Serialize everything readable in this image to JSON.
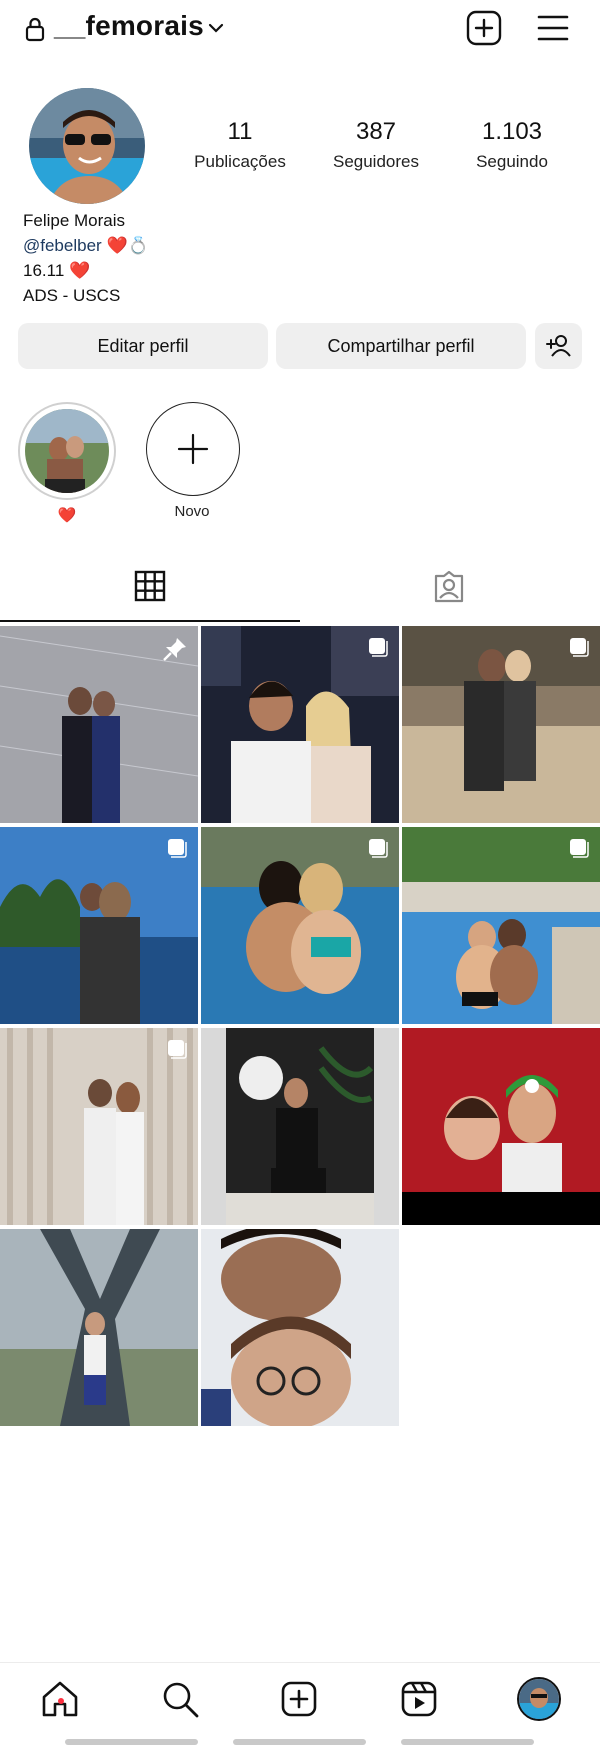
{
  "header": {
    "username": "__femorais",
    "icons": [
      "lock-icon",
      "chevron-down-icon",
      "new-post-icon",
      "menu-icon"
    ]
  },
  "profile": {
    "stats": [
      {
        "value": "11",
        "label": "Publicações"
      },
      {
        "value": "387",
        "label": "Seguidores"
      },
      {
        "value": "1.103",
        "label": "Seguindo"
      }
    ],
    "name": "Felipe Morais",
    "handle": "@febelber",
    "handle_emoji": "❤️💍",
    "line2": "16.11 ❤️",
    "line3": "ADS - USCS"
  },
  "actions": {
    "edit": "Editar perfil",
    "share": "Compartilhar perfil"
  },
  "highlights": [
    {
      "label": "❤️"
    },
    {
      "label": "Novo"
    }
  ],
  "tabs": [
    "grid-icon",
    "tagged-icon"
  ],
  "posts": [
    {
      "marker": "pinned"
    },
    {
      "marker": "carousel"
    },
    {
      "marker": "carousel"
    },
    {
      "marker": "carousel"
    },
    {
      "marker": "carousel"
    },
    {
      "marker": "carousel"
    },
    {
      "marker": "carousel"
    },
    {
      "marker": "none"
    },
    {
      "marker": "none"
    },
    {
      "marker": "none"
    },
    {
      "marker": "none"
    }
  ],
  "bottom_nav": [
    "home-icon",
    "search-icon",
    "create-icon",
    "reels-icon",
    "profile-avatar"
  ],
  "colors": {
    "accent_dot": "#ff3040",
    "button_bg": "#efefef",
    "handle": "#1e3a5f"
  }
}
